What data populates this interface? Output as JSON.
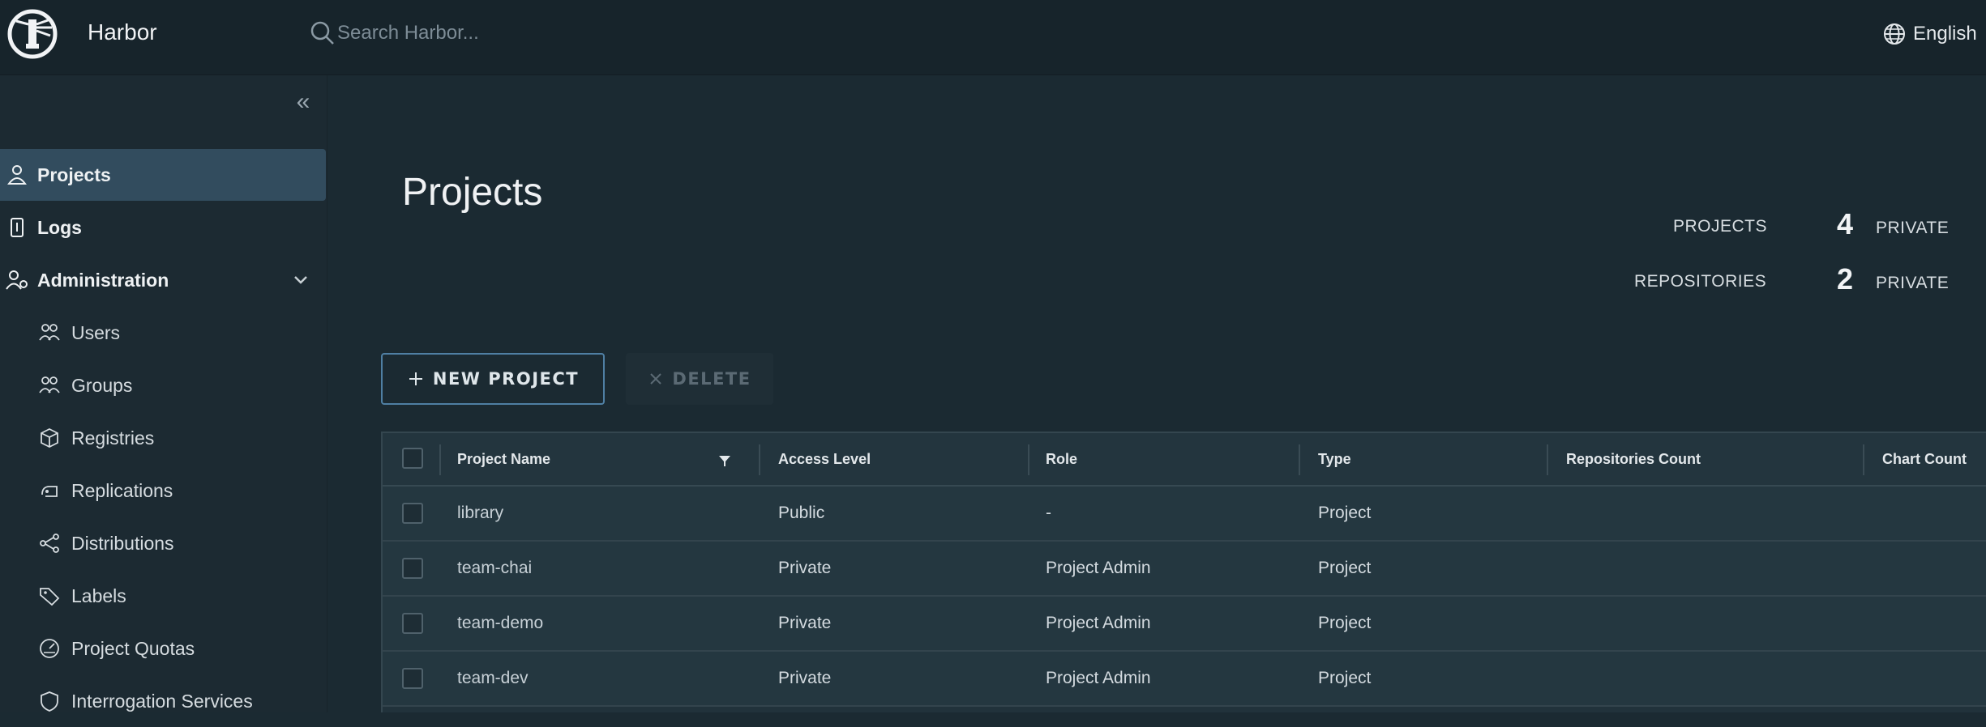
{
  "header": {
    "brand": "Harbor",
    "search_placeholder": "Search Harbor...",
    "language": "English"
  },
  "sidebar": {
    "collapse": "«",
    "items": [
      {
        "label": "Projects",
        "icon": "projects-icon",
        "active": true
      },
      {
        "label": "Logs",
        "icon": "logs-icon"
      },
      {
        "label": "Administration",
        "icon": "administration-icon"
      }
    ],
    "admin_items": [
      {
        "label": "Users",
        "icon": "users-icon"
      },
      {
        "label": "Groups",
        "icon": "groups-icon"
      },
      {
        "label": "Registries",
        "icon": "registries-icon"
      },
      {
        "label": "Replications",
        "icon": "replications-icon"
      },
      {
        "label": "Distributions",
        "icon": "distributions-icon"
      },
      {
        "label": "Labels",
        "icon": "labels-icon"
      },
      {
        "label": "Project Quotas",
        "icon": "project-quotas-icon"
      },
      {
        "label": "Interrogation Services",
        "icon": "interrogation-services-icon"
      }
    ]
  },
  "main": {
    "title": "Projects",
    "stats": [
      {
        "label": "PROJECTS",
        "count": "4",
        "kind": "PRIVATE"
      },
      {
        "label": "REPOSITORIES",
        "count": "2",
        "kind": "PRIVATE"
      }
    ],
    "new_project_label": "NEW PROJECT",
    "delete_label": "DELETE"
  },
  "table": {
    "columns": [
      "Project Name",
      "Access Level",
      "Role",
      "Type",
      "Repositories Count",
      "Chart Count"
    ],
    "rows": [
      {
        "name": "library",
        "access": "Public",
        "role": "-",
        "type": "Project"
      },
      {
        "name": "team-chai",
        "access": "Private",
        "role": "Project Admin",
        "type": "Project"
      },
      {
        "name": "team-demo",
        "access": "Private",
        "role": "Project Admin",
        "type": "Project"
      },
      {
        "name": "team-dev",
        "access": "Private",
        "role": "Project Admin",
        "type": "Project"
      }
    ]
  },
  "colors": {
    "header_bg": "#17242b",
    "sidebar_bg": "#1c2a32",
    "active_item_bg": "#324c5e",
    "accent_border": "#4f7fa3"
  }
}
